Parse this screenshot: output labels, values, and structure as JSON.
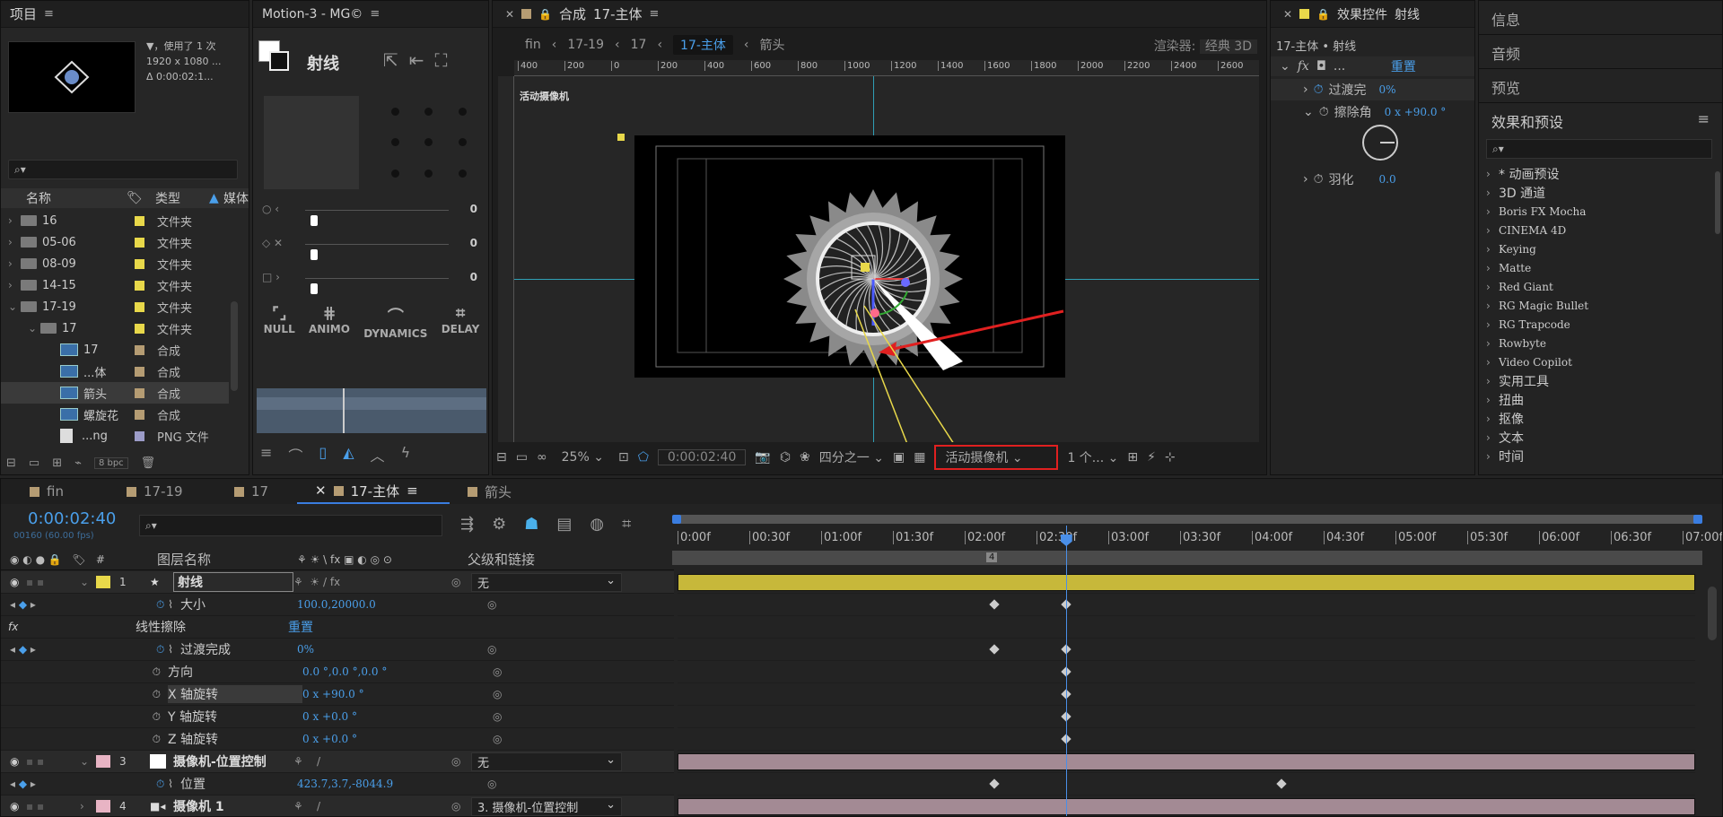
{
  "project": {
    "title": "项目",
    "info_line1": "▼，使用了 1 次",
    "info_line2": "1920 x 1080 ...",
    "info_line3": "Δ 0:00:02:1...",
    "col_name": "名称",
    "col_type": "类型",
    "col_media": "媒体",
    "items": [
      {
        "name": "16",
        "type": "文件夹",
        "indent": 0,
        "color": "#e8d84a",
        "icon": "folder",
        "arrow": ">"
      },
      {
        "name": "05-06",
        "type": "文件夹",
        "indent": 0,
        "color": "#e8d84a",
        "icon": "folder",
        "arrow": ">"
      },
      {
        "name": "08-09",
        "type": "文件夹",
        "indent": 0,
        "color": "#e8d84a",
        "icon": "folder",
        "arrow": ">"
      },
      {
        "name": "14-15",
        "type": "文件夹",
        "indent": 0,
        "color": "#e8d84a",
        "icon": "folder",
        "arrow": ">"
      },
      {
        "name": "17-19",
        "type": "文件夹",
        "indent": 0,
        "color": "#e8d84a",
        "icon": "folder",
        "arrow": "v"
      },
      {
        "name": "17",
        "type": "文件夹",
        "indent": 1,
        "color": "#e8d84a",
        "icon": "folder",
        "arrow": "v"
      },
      {
        "name": "17",
        "type": "合成",
        "indent": 2,
        "color": "#b59c73",
        "icon": "comp",
        "arrow": ""
      },
      {
        "name": "...体",
        "type": "合成",
        "indent": 2,
        "color": "#b59c73",
        "icon": "comp",
        "arrow": ""
      },
      {
        "name": "箭头",
        "type": "合成",
        "indent": 2,
        "color": "#b59c73",
        "icon": "comp",
        "arrow": ""
      },
      {
        "name": "螺旋花",
        "type": "合成",
        "indent": 2,
        "color": "#b59c73",
        "icon": "comp",
        "arrow": ""
      },
      {
        "name": "...ng",
        "type": "PNG 文件",
        "indent": 2,
        "color": "#9c9cc8",
        "icon": "file",
        "arrow": ""
      }
    ],
    "bpc": "8 bpc"
  },
  "motion": {
    "title": "Motion-3 - MG©",
    "layer_name": "射线",
    "slider_values": [
      "0",
      "0",
      "0"
    ],
    "buttons": [
      "NULL",
      "ANIMO",
      "DYNAMICS",
      "DELAY"
    ]
  },
  "comp": {
    "title_prefix": "合成",
    "title_name": "17-主体",
    "breadcrumbs": [
      "fin",
      "17-19",
      "17",
      "17-主体",
      "箭头"
    ],
    "renderer_label": "渲染器:",
    "renderer_value": "经典 3D",
    "ruler_ticks": [
      "400",
      "200",
      "0",
      "200",
      "400",
      "600",
      "800",
      "1000",
      "1200",
      "1400",
      "1600",
      "1800",
      "2000",
      "2200",
      "2400",
      "2600"
    ],
    "camera_label": "活动摄像机",
    "zoom": "25%",
    "timecode": "0:00:02:40",
    "resolution": "四分之一",
    "view_dropdown": "活动摄像机",
    "views": "1 个..."
  },
  "effects": {
    "title": "效果控件",
    "title_layer": "射线",
    "subtitle": "17-主体 • 射线",
    "fx_name": "...",
    "reset": "重置",
    "props": [
      {
        "label": "过渡完",
        "value": "0%"
      },
      {
        "label": "擦除角",
        "value": "0 x +90.0 °"
      },
      {
        "label": "羽化",
        "value": "0.0"
      }
    ]
  },
  "right_panel": {
    "tabs": [
      "信息",
      "音频",
      "预览",
      "效果和预设"
    ],
    "search_placeholder": "",
    "presets": [
      "* 动画预设",
      "3D 通道",
      "Boris FX Mocha",
      "CINEMA 4D",
      "Keying",
      "Matte",
      "Red Giant",
      "RG Magic Bullet",
      "RG Trapcode",
      "Rowbyte",
      "Video Copilot",
      "实用工具",
      "扭曲",
      "抠像",
      "文本",
      "时间"
    ]
  },
  "timeline": {
    "tabs": [
      {
        "label": "fin",
        "active": false
      },
      {
        "label": "17-19",
        "active": false
      },
      {
        "label": "17",
        "active": false
      },
      {
        "label": "17-主体",
        "active": true
      },
      {
        "label": "箭头",
        "active": false
      }
    ],
    "timecode": "0:00:02:40",
    "frame_info": "00160 (60.00 fps)",
    "col_layer_name": "图层名称",
    "col_parent": "父级和链接",
    "ruler": [
      "0:00f",
      "00:30f",
      "01:00f",
      "01:30f",
      "02:00f",
      "02:30f",
      "03:00f",
      "03:30f",
      "04:00f",
      "04:30f",
      "05:00f",
      "05:30f",
      "06:00f",
      "06:30f",
      "07:00f"
    ],
    "current_time_seconds": 2.667,
    "duration_seconds": 7,
    "rows": [
      {
        "kind": "layer",
        "num": "1",
        "name": "射线",
        "label_color": "#e8d84a",
        "parent": "无",
        "bar": "#c7b83a",
        "icon": "star"
      },
      {
        "kind": "prop",
        "name": "大小",
        "value": "100.0,20000.0",
        "indent": 2
      },
      {
        "kind": "fx",
        "name": "线性擦除",
        "value": "重置",
        "indent": 1
      },
      {
        "kind": "prop",
        "name": "过渡完成",
        "value": "0%",
        "indent": 3
      },
      {
        "kind": "prop",
        "name": "方向",
        "value": "0.0 °,0.0 °,0.0 °",
        "indent": 2
      },
      {
        "kind": "prop",
        "name": "X 轴旋转",
        "value": "0 x +90.0 °",
        "indent": 2
      },
      {
        "kind": "prop",
        "name": "Y 轴旋转",
        "value": "0 x +0.0 °",
        "indent": 2
      },
      {
        "kind": "prop",
        "name": "Z 轴旋转",
        "value": "0 x +0.0 °",
        "indent": 2
      },
      {
        "kind": "layer",
        "num": "3",
        "name": "摄像机-位置控制",
        "label_color": "#e8b4c4",
        "parent": "无",
        "bar": "#a38a94",
        "icon": "solid"
      },
      {
        "kind": "prop",
        "name": "位置",
        "value": "423.7,3.7,-8044.9",
        "indent": 2
      },
      {
        "kind": "layer",
        "num": "4",
        "name": "摄像机 1",
        "label_color": "#e8b4c4",
        "parent": "3. 摄像机-位置控制",
        "bar": "#a38a94",
        "icon": "camera"
      }
    ],
    "keyframes": [
      {
        "row": 1,
        "times": [
          2.17,
          2.667
        ]
      },
      {
        "row": 3,
        "times": [
          2.17,
          2.667
        ]
      },
      {
        "row": 4,
        "times": [
          2.667
        ]
      },
      {
        "row": 5,
        "times": [
          2.667
        ]
      },
      {
        "row": 6,
        "times": [
          2.667
        ]
      },
      {
        "row": 7,
        "times": [
          2.667
        ]
      },
      {
        "row": 9,
        "times": [
          2.17,
          4.17
        ]
      }
    ]
  },
  "colors": {
    "accent": "#4a9fea",
    "highlight_box": "#e02020",
    "arrow": "#e02020"
  }
}
